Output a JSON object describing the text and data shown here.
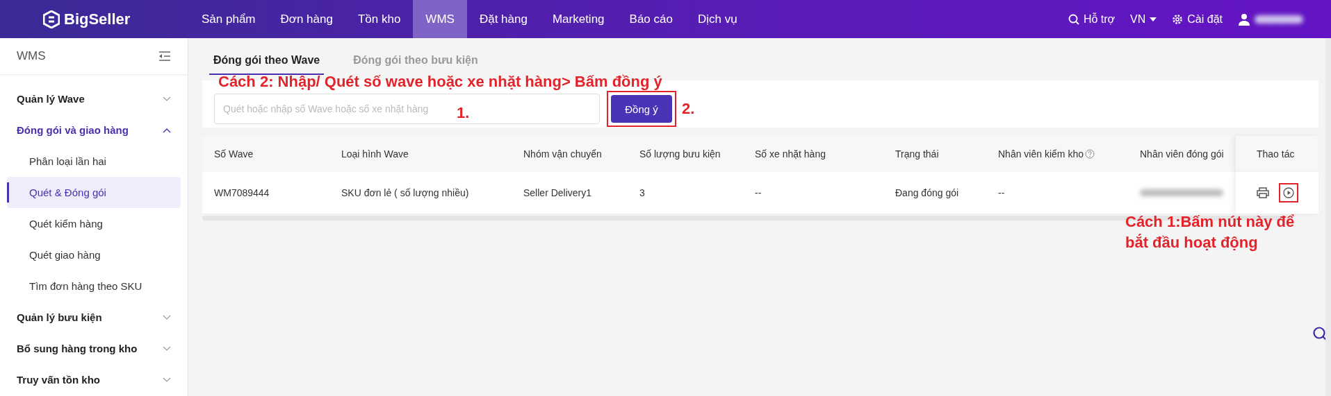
{
  "header": {
    "logo": "BigSeller",
    "nav": [
      {
        "label": "Sản phẩm",
        "selected": false
      },
      {
        "label": "Đơn hàng",
        "selected": false
      },
      {
        "label": "Tồn kho",
        "selected": false
      },
      {
        "label": "WMS",
        "selected": true
      },
      {
        "label": "Đặt hàng",
        "selected": false
      },
      {
        "label": "Marketing",
        "selected": false
      },
      {
        "label": "Báo cáo",
        "selected": false
      },
      {
        "label": "Dịch vụ",
        "selected": false
      }
    ],
    "help": "Hỗ trợ",
    "language": "VN",
    "settings": "Cài đặt"
  },
  "sidebar": {
    "title": "WMS",
    "groups": [
      {
        "label": "Quản lý Wave",
        "expanded": false
      },
      {
        "label": "Đóng gói và giao hàng",
        "expanded": true,
        "children": [
          {
            "label": "Phân loại lần hai",
            "selected": false
          },
          {
            "label": "Quét & Đóng gói",
            "selected": true
          },
          {
            "label": "Quét kiểm hàng",
            "selected": false
          },
          {
            "label": "Quét giao hàng",
            "selected": false
          },
          {
            "label": "Tìm đơn hàng theo SKU",
            "selected": false
          }
        ]
      },
      {
        "label": "Quản lý bưu kiện",
        "expanded": false
      },
      {
        "label": "Bổ sung hàng trong kho",
        "expanded": false
      },
      {
        "label": "Truy vấn tồn kho",
        "expanded": false
      }
    ]
  },
  "tabs": [
    {
      "label": "Đóng gói theo Wave",
      "selected": true
    },
    {
      "label": "Đóng gói theo bưu kiện",
      "selected": false
    }
  ],
  "scan": {
    "placeholder": "Quét hoặc nhập số Wave hoặc số xe nhặt hàng",
    "button": "Đồng ý"
  },
  "annotations": {
    "instruction_top": "Cách 2: Nhập/ Quét số wave hoặc xe nhặt hàng> Bấm đồng ý",
    "step_1": "1.",
    "step_2": "2.",
    "instruction_right": "Cách 1:Bấm nút này để bắt đầu hoạt động"
  },
  "table": {
    "columns": [
      {
        "label": "Số Wave",
        "help": false
      },
      {
        "label": "Loại hình Wave",
        "help": false
      },
      {
        "label": "Nhóm vận chuyển",
        "help": false
      },
      {
        "label": "Số lượng bưu kiện",
        "help": false
      },
      {
        "label": "Số xe nhặt hàng",
        "help": false
      },
      {
        "label": "Trạng thái",
        "help": false
      },
      {
        "label": "Nhân viên kiểm kho",
        "help": true
      },
      {
        "label": "Nhân viên đóng gói",
        "help": false
      },
      {
        "label": "Thao tác",
        "help": false
      }
    ],
    "rows": [
      {
        "cells": [
          "WM7089444",
          "SKU đơn lẻ ( số lượng nhiều)",
          "Seller Delivery1",
          "3",
          "--",
          "Đang đóng gói",
          "--"
        ]
      }
    ]
  }
}
